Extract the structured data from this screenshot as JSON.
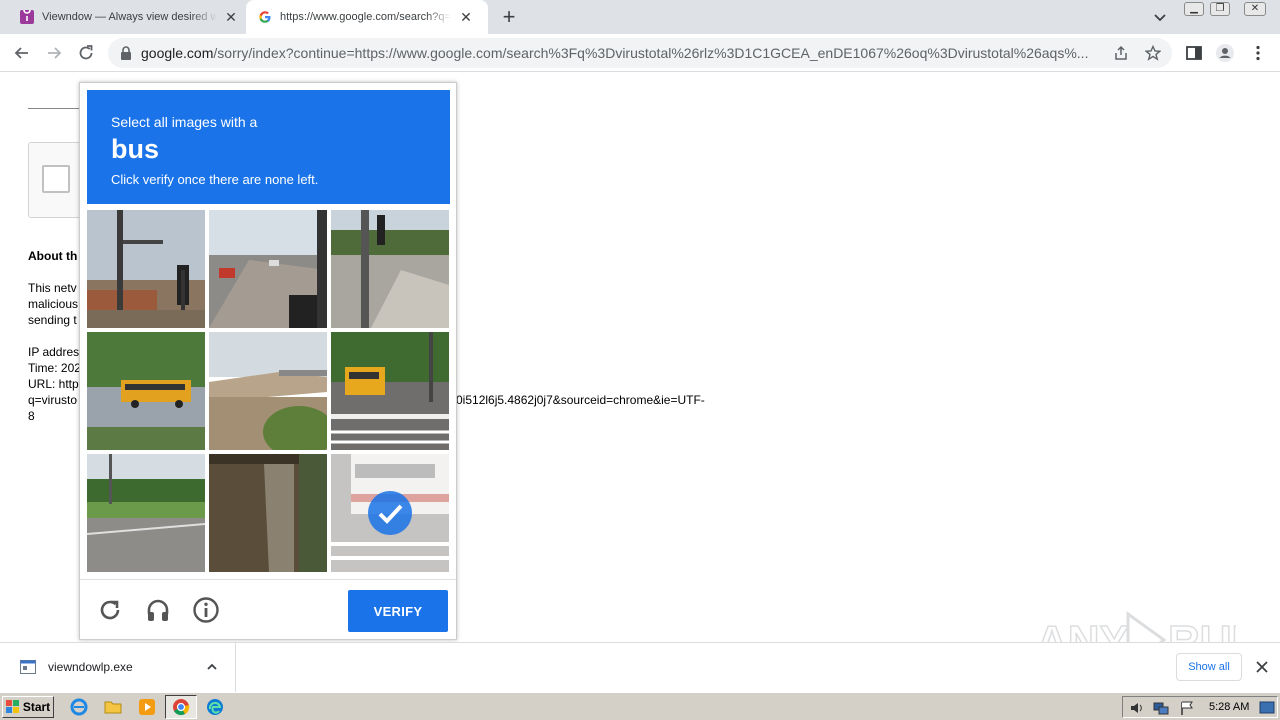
{
  "tabs": [
    {
      "title": "Viewndow — Always view desired w",
      "favicon": "viewndow-logo-icon",
      "active": false
    },
    {
      "title": "https://www.google.com/search?q=",
      "favicon": "google-g-icon",
      "active": true
    }
  ],
  "toolbar": {
    "url_host": "google.com",
    "url_rest": "/sorry/index?continue=https://www.google.com/search%3Fq%3Dvirustotal%26rlz%3D1C1GCEA_enDE1067%26oq%3Dvirustotal%26aqs%..."
  },
  "page": {
    "about_heading": "About th",
    "line1": "This netv",
    "line2": "malicious",
    "line3": "sending t",
    "ip_label": "IP addres",
    "time_label": "Time: 202",
    "url_label": "URL: http",
    "url_cont_left": "q=virusto",
    "url_cont_right": "0i512l6j5.4862j0j7&sourceid=chrome&ie=UTF-",
    "url_tail": "8"
  },
  "captcha": {
    "instruction_top": "Select all images with a",
    "target_word": "bus",
    "instruction_bottom": "Click verify once there are none left.",
    "verify_label": "VERIFY",
    "tiles": [
      {
        "selected": false
      },
      {
        "selected": false
      },
      {
        "selected": false
      },
      {
        "selected": false
      },
      {
        "selected": false
      },
      {
        "selected": false
      },
      {
        "selected": false
      },
      {
        "selected": false
      },
      {
        "selected": true
      }
    ],
    "accent_color": "#1a73e8"
  },
  "downloads": {
    "file_name": "viewndowlp.exe",
    "show_all_label": "Show all"
  },
  "taskbar": {
    "start_label": "Start",
    "clock": "5:28 AM"
  },
  "watermark": "ANY RUN"
}
